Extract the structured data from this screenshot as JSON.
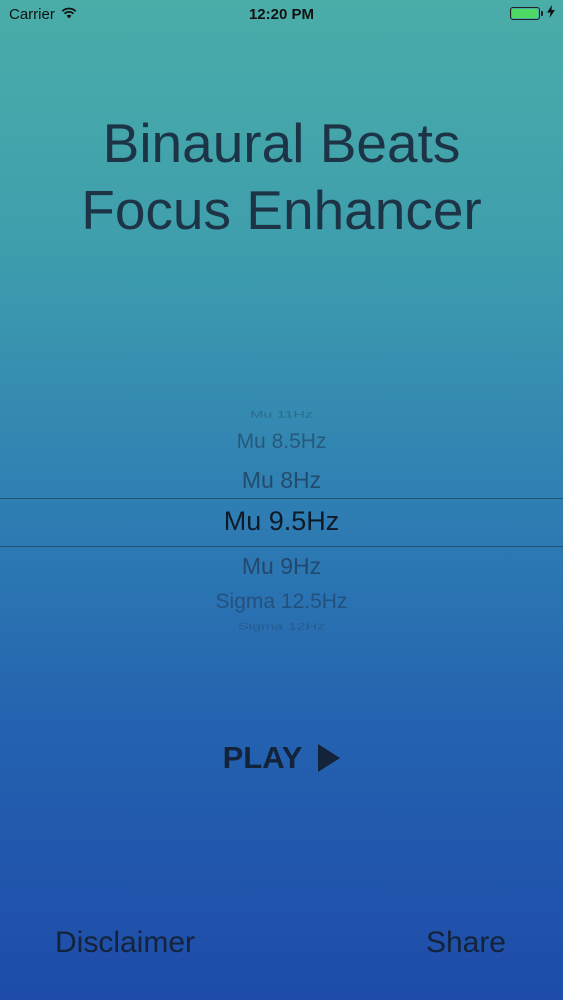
{
  "status_bar": {
    "carrier": "Carrier",
    "time": "12:20 PM",
    "battery_level": 1.0,
    "battery_color": "#4cd964"
  },
  "title": {
    "line1": "Binaural Beats",
    "line2": "Focus Enhancer"
  },
  "picker": {
    "rows": [
      "Mu 11Hz",
      "Mu 8.5Hz",
      "Mu 8Hz",
      "Mu 9.5Hz",
      "Mu 9Hz",
      "Sigma 12.5Hz",
      "Sigma 12Hz"
    ],
    "selected": "Mu 9.5Hz"
  },
  "play_label": "PLAY",
  "footer": {
    "disclaimer_label": "Disclaimer",
    "share_label": "Share"
  },
  "icons": {
    "wifi": "wifi-icon",
    "battery": "battery-icon",
    "charging": "charging-bolt-icon",
    "play": "play-icon"
  }
}
